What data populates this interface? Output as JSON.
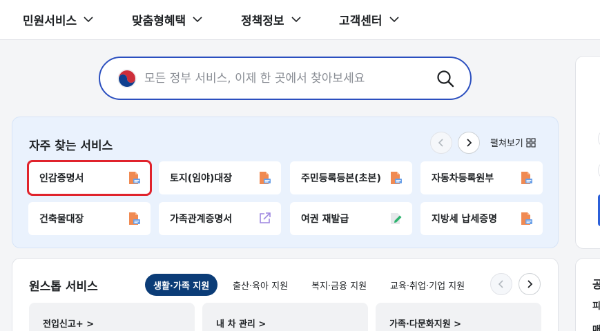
{
  "nav": {
    "items": [
      "민원서비스",
      "맞춤형혜택",
      "정책정보",
      "고객센터"
    ]
  },
  "search": {
    "placeholder": "모든 정부 서비스, 이제 한 곳에서 찾아보세요",
    "value": ""
  },
  "frequent": {
    "title": "자주 찾는 서비스",
    "expand_label": "펼쳐보기",
    "services": [
      {
        "label": "인감증명서",
        "icon": "pdf-document-icon",
        "selected": true
      },
      {
        "label": "토지(임야)대장",
        "icon": "pdf-document-icon"
      },
      {
        "label": "주민등록등본(초본)",
        "icon": "pdf-document-icon"
      },
      {
        "label": "자동차등록원부",
        "icon": "pdf-document-icon"
      },
      {
        "label": "건축물대장",
        "icon": "pdf-document-icon"
      },
      {
        "label": "가족관계증명서",
        "icon": "external-link-icon"
      },
      {
        "label": "여권 재발급",
        "icon": "edit-document-icon"
      },
      {
        "label": "지방세 납세증명",
        "icon": "pdf-document-icon"
      }
    ]
  },
  "onestop": {
    "title": "원스톱 서비스",
    "tabs": [
      "생활·가족 지원",
      "출산·육아 지원",
      "복지·금융 지원",
      "교육·취업·기업 지원"
    ],
    "active_tab": 0,
    "cards": [
      "전입신고+ >",
      "내 차 관리 >",
      "가족·다문화지원 >"
    ]
  },
  "right_panel": {
    "fragments": [
      "공",
      "피",
      "매"
    ]
  },
  "colors": {
    "accent_blue": "#2b4fbf",
    "active_chip": "#0b3c77",
    "selection_outline": "#e0232c",
    "panel_bg": "#eaf2fd"
  }
}
